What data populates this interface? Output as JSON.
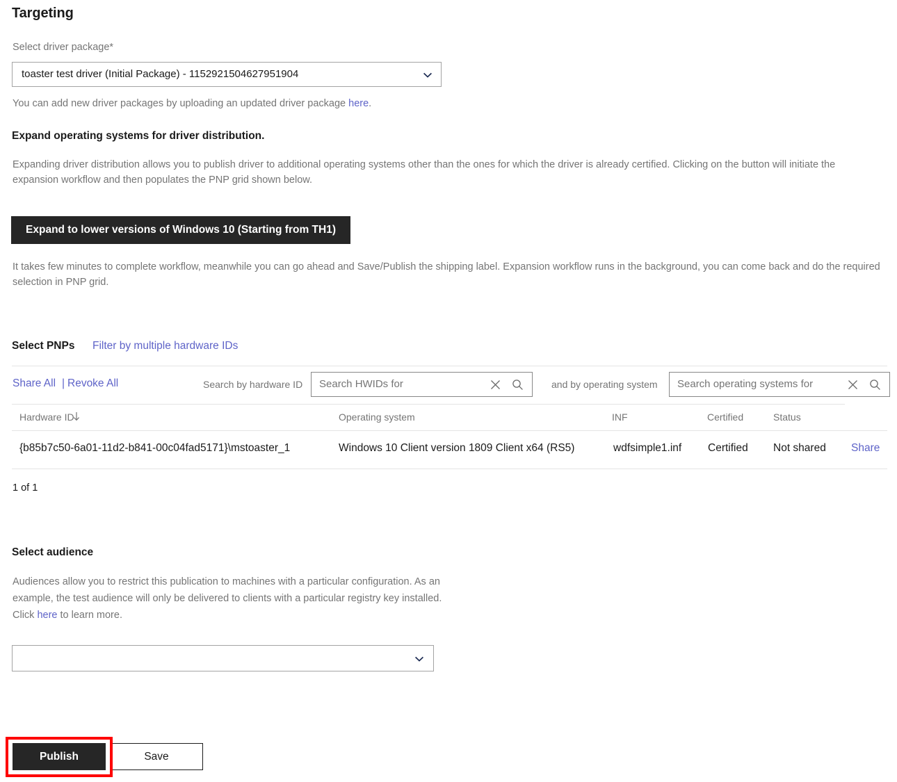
{
  "page": {
    "title": "Targeting"
  },
  "driver_package": {
    "label": "Select driver package*",
    "selected_value": "toaster test driver (Initial Package) - 1152921504627951904",
    "help_text_before": "You can add new driver packages by uploading an updated driver package ",
    "help_link": "here",
    "help_text_after": "."
  },
  "expand": {
    "heading": "Expand operating systems for driver distribution.",
    "description": "Expanding driver distribution allows you to publish driver to additional operating systems other than the ones for which the driver is already certified. Clicking on the button will initiate the expansion workflow and then populates the PNP grid shown below.",
    "button_label": "Expand to lower versions of Windows 10 (Starting from TH1)",
    "note": "It takes few minutes to complete workflow, meanwhile you can go ahead and Save/Publish the shipping label. Expansion workflow runs in the background, you can come back and do the required selection in PNP grid."
  },
  "pnp": {
    "heading": "Select PNPs",
    "filter_link": "Filter by multiple hardware IDs",
    "share_all": "Share All",
    "separator": "|",
    "revoke_all": "Revoke All",
    "search_hwid_label": "Search by hardware ID",
    "search_hwid_placeholder": "Search HWIDs for",
    "search_hwid_value": "",
    "search_os_label": "and by operating system",
    "search_os_placeholder": "Search operating systems for",
    "search_os_value": "",
    "columns": {
      "hardware_id": "Hardware ID",
      "operating_system": "Operating system",
      "inf": "INF",
      "certified": "Certified",
      "status": "Status"
    },
    "sort_icon": "sort-descending-arrow-icon",
    "rows": [
      {
        "hardware_id": "{b85b7c50-6a01-11d2-b841-00c04fad5171}\\mstoaster_1",
        "operating_system": "Windows 10 Client version 1809 Client x64 (RS5)",
        "inf": "wdfsimple1.inf",
        "certified": "Certified",
        "status": "Not shared",
        "action": "Share"
      }
    ],
    "count_text": "1 of 1"
  },
  "audience": {
    "heading": "Select audience",
    "description_before": "Audiences allow you to restrict this publication to machines with a particular configuration. As an example, the test audience will only be delivered to clients with a particular registry key installed. Click ",
    "description_link": "here",
    "description_after": " to learn more.",
    "selected_value": ""
  },
  "footer": {
    "publish_label": "Publish",
    "save_label": "Save"
  },
  "colors": {
    "link": "#5e63c8",
    "primary_button_bg": "#262626",
    "highlight_border": "#fe0000",
    "muted_text": "#757575",
    "body_text": "#1b1b1b"
  }
}
